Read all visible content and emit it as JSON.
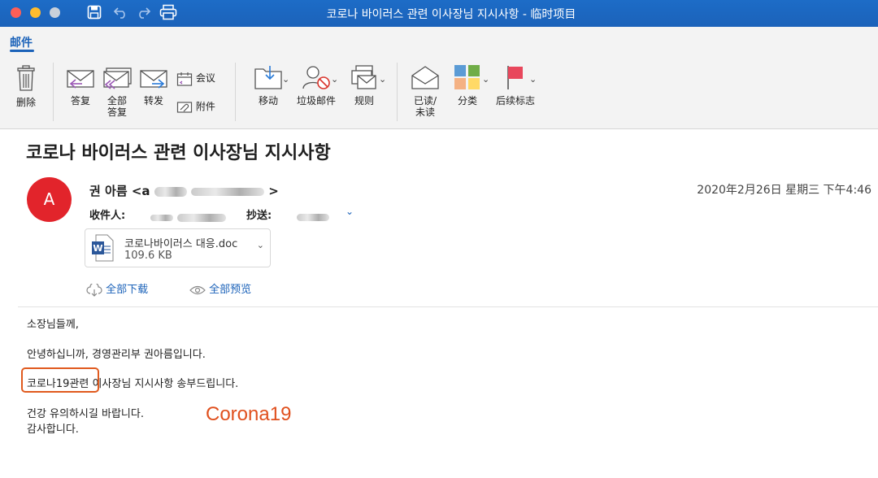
{
  "window": {
    "title": "코로나 바이러스 관련 이사장님 지시사항 - 临时项目"
  },
  "ribbon": {
    "tab": "邮件",
    "delete": "删除",
    "reply": "答复",
    "reply_all_1": "全部",
    "reply_all_2": "答复",
    "forward": "转发",
    "meeting": "会议",
    "attachment": "附件",
    "move": "移动",
    "junk": "垃圾邮件",
    "rules": "规则",
    "read_1": "已读/",
    "read_2": "未读",
    "categorize": "分类",
    "followup": "后续标志"
  },
  "message": {
    "subject": "코로나 바이러스 관련 이사장님 지시사항",
    "avatar_letter": "A",
    "sender_name": "권 아름 <a",
    "sender_end": ">",
    "date": "2020年2月26日 星期三 下午4:46",
    "to_label": "收件人:",
    "cc_label": "抄送:",
    "attachment": {
      "name": "코로나바이러스 대응.doc",
      "size": "109.6 KB"
    },
    "download_all": "全部下载",
    "preview_all": "全部预览",
    "body": {
      "line1": "소장님들께,",
      "line2": "안녕하십니까, 경영관리부 권아름입니다.",
      "line3_highlight": "코로나19관련",
      "line3_rest": " 이사장님 지시사항 송부드립니다.",
      "line4": "건강 유의하시길 바랍니다.",
      "line5": "감사합니다."
    },
    "annotation": "Corona19"
  },
  "colors": {
    "titlebar": "#1b62b9",
    "avatar": "#e2242b",
    "annotation": "#e0501e"
  }
}
